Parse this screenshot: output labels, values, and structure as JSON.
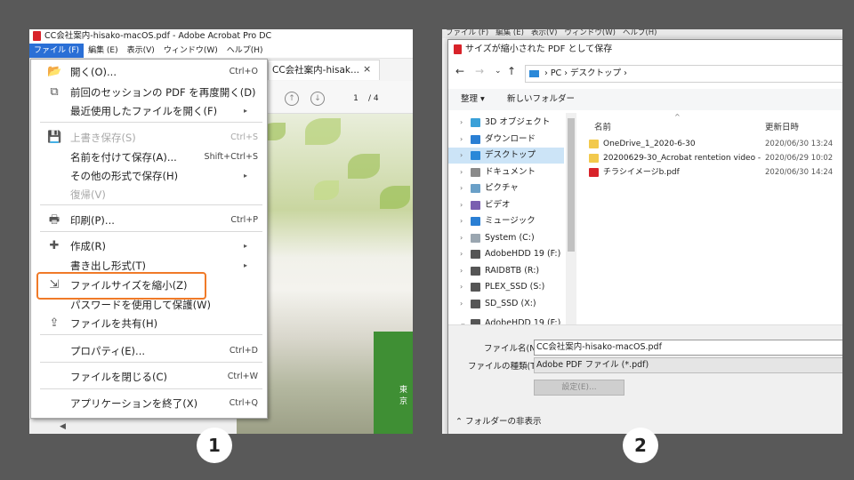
{
  "panel1": {
    "title": "CC会社案内-hisako-macOS.pdf - Adobe Acrobat Pro DC",
    "menubar": [
      "ファイル (F)",
      "編集 (E)",
      "表示(V)",
      "ウィンドウ(W)",
      "ヘルプ(H)"
    ],
    "tab_label": "CC会社案内-hisak...",
    "tab_close": "×",
    "page_current": "1",
    "page_total": "/ 4",
    "green_text": "東京",
    "file_menu": [
      {
        "icon": "open-folder-icon",
        "glyph": "📂",
        "label": "開く(O)...",
        "shortcut": "Ctrl+O"
      },
      {
        "icon": "restore-session-icon",
        "glyph": "⧉",
        "label": "前回のセッションの PDF を再度開く(D)",
        "shortcut": ""
      },
      {
        "icon": "",
        "glyph": "",
        "label": "最近使用したファイルを開く(F)",
        "shortcut": "",
        "submenu": true
      },
      {
        "icon": "save-icon",
        "glyph": "💾",
        "label": "上書き保存(S)",
        "shortcut": "Ctrl+S",
        "disabled": true
      },
      {
        "icon": "",
        "glyph": "",
        "label": "名前を付けて保存(A)...",
        "shortcut": "Shift+Ctrl+S"
      },
      {
        "icon": "",
        "glyph": "",
        "label": "その他の形式で保存(H)",
        "shortcut": "",
        "submenu": true
      },
      {
        "icon": "",
        "glyph": "",
        "label": "復帰(V)",
        "shortcut": "",
        "disabled": true
      },
      {
        "icon": "print-icon",
        "glyph": "🖶",
        "label": "印刷(P)...",
        "shortcut": "Ctrl+P"
      },
      {
        "icon": "create-icon",
        "glyph": "✚",
        "label": "作成(R)",
        "shortcut": "",
        "submenu": true
      },
      {
        "icon": "",
        "glyph": "",
        "label": "書き出し形式(T)",
        "shortcut": "",
        "submenu": true
      },
      {
        "icon": "reduce-size-icon",
        "glyph": "⇲",
        "label": "ファイルサイズを縮小(Z)",
        "shortcut": ""
      },
      {
        "icon": "",
        "glyph": "",
        "label": "パスワードを使用して保護(W)",
        "shortcut": ""
      },
      {
        "icon": "share-icon",
        "glyph": "⇪",
        "label": "ファイルを共有(H)",
        "shortcut": ""
      },
      {
        "icon": "",
        "glyph": "",
        "label": "プロパティ(E)...",
        "shortcut": "Ctrl+D"
      },
      {
        "icon": "",
        "glyph": "",
        "label": "ファイルを閉じる(C)",
        "shortcut": "Ctrl+W"
      },
      {
        "icon": "",
        "glyph": "",
        "label": "アプリケーションを終了(X)",
        "shortcut": "Ctrl+Q"
      }
    ],
    "badge": "1"
  },
  "panel2": {
    "bg_menubar": [
      "ファイル (F)",
      "編集 (E)",
      "表示(V)",
      "ウィンドウ(W)",
      "ヘルプ(H)"
    ],
    "dialog_title": "サイズが縮小された PDF として保存",
    "address": [
      "PC",
      "デスクトップ"
    ],
    "organize": "整理 ▾",
    "new_folder": "新しいフォルダー",
    "tree": [
      {
        "label": "3D オブジェクト",
        "color": "#3aa0d8"
      },
      {
        "label": "ダウンロード",
        "color": "#2a7fd4"
      },
      {
        "label": "デスクトップ",
        "color": "#2a88d8",
        "selected": true
      },
      {
        "label": "ドキュメント",
        "color": "#8a8a8a"
      },
      {
        "label": "ピクチャ",
        "color": "#6aa0c8"
      },
      {
        "label": "ビデオ",
        "color": "#7a5fb0"
      },
      {
        "label": "ミュージック",
        "color": "#2a7fd4"
      },
      {
        "label": "System (C:)",
        "color": "#9aa6b0"
      },
      {
        "label": "AdobeHDD 19 (F:)",
        "color": "#555555"
      },
      {
        "label": "RAID8TB (R:)",
        "color": "#555555"
      },
      {
        "label": "PLEX_SSD (S:)",
        "color": "#555555"
      },
      {
        "label": "SD_SSD (X:)",
        "color": "#555555"
      },
      {
        "label": "AdobeHDD 19 (F:)",
        "color": "#555555",
        "expanded": true
      }
    ],
    "columns": {
      "name": "名前",
      "date": "更新日時"
    },
    "files": [
      {
        "name": "OneDrive_1_2020-6-30",
        "date": "2020/06/30 13:24",
        "type": "folder"
      },
      {
        "name": "20200629-30_Acrobat rentetion video - シ...",
        "date": "2020/06/29 10:02",
        "type": "folder"
      },
      {
        "name": "チラシイメージb.pdf",
        "date": "2020/06/30 14:24",
        "type": "pdf"
      }
    ],
    "filename_label": "ファイル名(N):",
    "filename_value": "CC会社案内-hisako-macOS.pdf",
    "filetype_label": "ファイルの種類(T):",
    "filetype_value": "Adobe PDF ファイル (*.pdf)",
    "settings_button": "設定(E)...",
    "hide_folders": "フォルダーの非表示",
    "badge": "2"
  }
}
